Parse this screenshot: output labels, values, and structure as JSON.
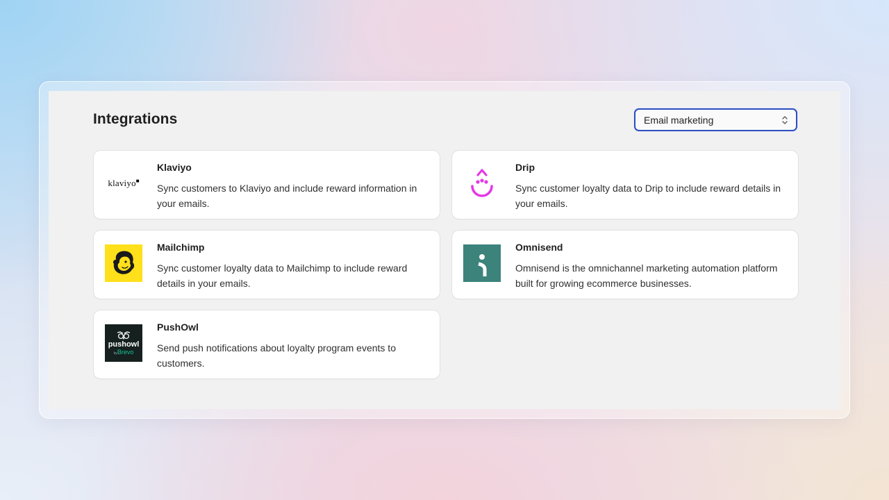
{
  "header": {
    "title": "Integrations"
  },
  "filter": {
    "selected": "Email marketing"
  },
  "integrations": [
    {
      "name": "Klaviyo",
      "logo": "klaviyo-logo",
      "logo_text": "klaviyo",
      "description": "Sync customers to Klaviyo and include reward information in your emails."
    },
    {
      "name": "Drip",
      "logo": "drip-logo",
      "description": "Sync customer loyalty data to Drip to include reward details in your emails."
    },
    {
      "name": "Mailchimp",
      "logo": "mailchimp-logo",
      "description": "Sync customer loyalty data to Mailchimp to include reward details in your emails."
    },
    {
      "name": "Omnisend",
      "logo": "omnisend-logo",
      "description": "Omnisend is the omnichannel marketing automation platform built for growing ecommerce businesses."
    },
    {
      "name": "PushOwl",
      "logo": "pushowl-logo",
      "logo_text": "pushowl",
      "logo_subtext": "Brevo",
      "logo_by": "by",
      "description": "Send push notifications about loyalty program events to customers."
    }
  ],
  "colors": {
    "select_border": "#2e4fbf",
    "drip": "#e43ae6",
    "mailchimp": "#ffe01b",
    "omnisend": "#3b837b",
    "pushowl_bg": "#15201f",
    "brevo": "#19c39a"
  }
}
